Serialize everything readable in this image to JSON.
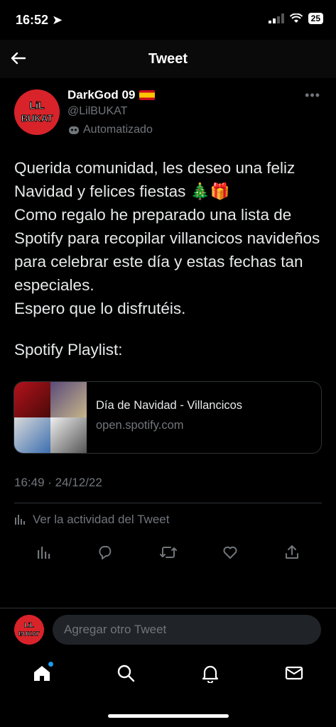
{
  "status": {
    "time": "16:52",
    "battery": "25"
  },
  "header": {
    "title": "Tweet"
  },
  "author": {
    "name": "DarkGod 09",
    "handle": "@LilBUKAT",
    "automated_label": "Automatizado",
    "avatar_text_1": "LiL",
    "avatar_text_2": "BUKAT"
  },
  "tweet": {
    "lines": [
      "Querida comunidad, les deseo una feliz Navidad y felices fiestas 🎄🎁",
      "Como regalo he preparado una lista de Spotify para recopilar villancicos navideños para celebrar este día y estas fechas tan especiales.",
      "Espero que lo disfrutéis."
    ],
    "playlist_label": "Spotify Playlist:",
    "timestamp": "16:49 · 24/12/22"
  },
  "card": {
    "title": "Día de Navidad - Villancicos",
    "url": "open.spotify.com"
  },
  "activity_label": "Ver la actividad del Tweet",
  "reply": {
    "placeholder": "Agregar otro Tweet"
  },
  "colors": {
    "background": "#000000",
    "text": "#e7e9ea",
    "muted": "#71767b",
    "accent": "#1d9bf0"
  },
  "icons": [
    "back-arrow-icon",
    "more-icon",
    "analytics-icon",
    "reply-icon",
    "retweet-icon",
    "like-icon",
    "share-icon",
    "home-icon",
    "search-icon",
    "notifications-icon",
    "messages-icon"
  ]
}
